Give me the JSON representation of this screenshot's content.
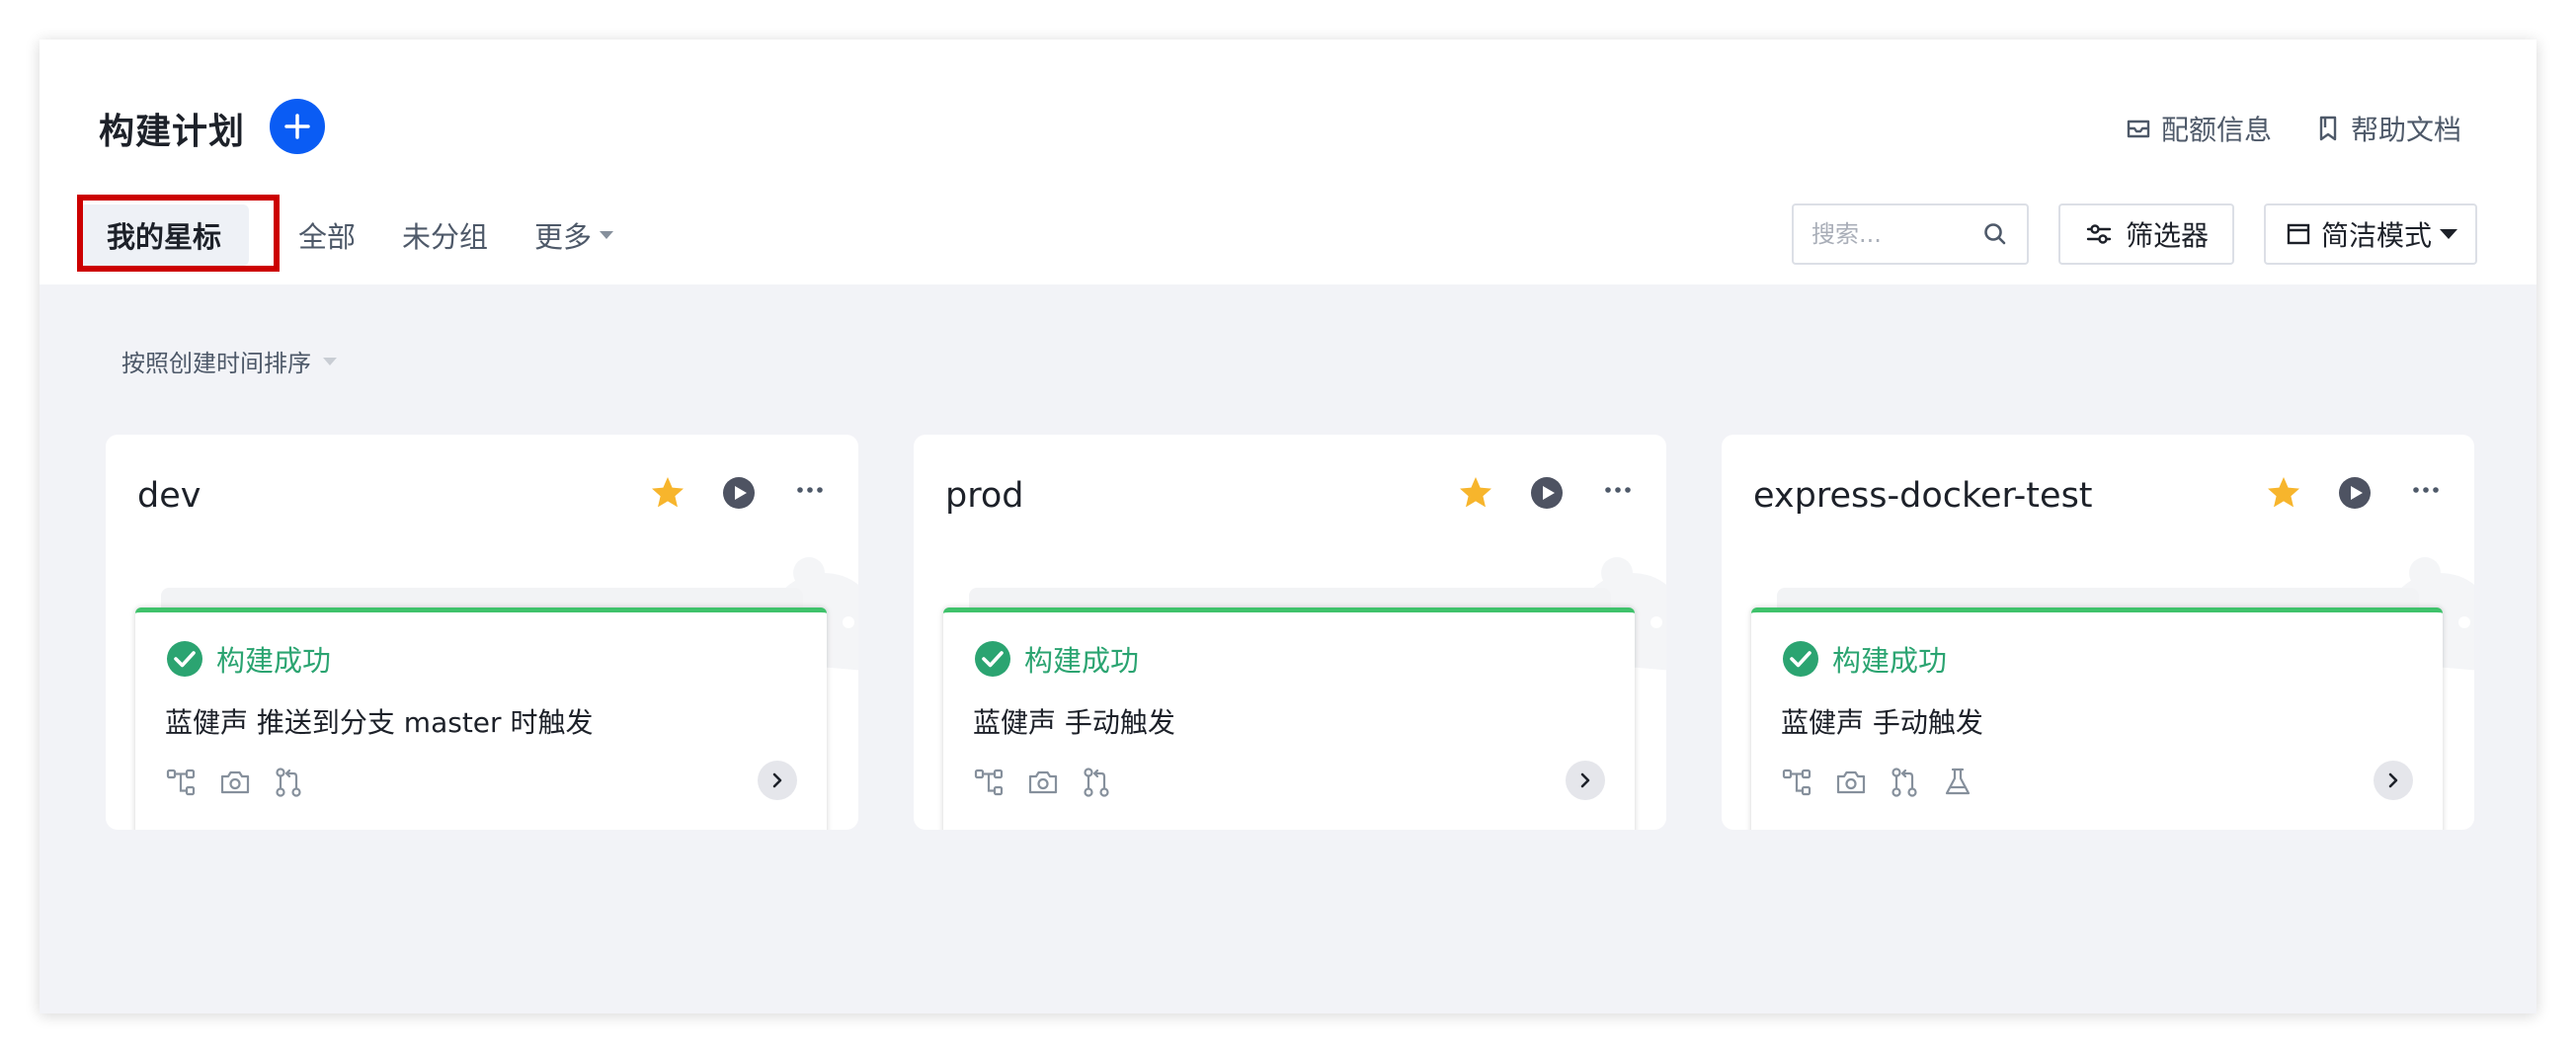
{
  "header": {
    "title": "构建计划",
    "add_icon": "plus-icon",
    "links": [
      {
        "label": "配额信息",
        "icon": "inbox-icon"
      },
      {
        "label": "帮助文档",
        "icon": "bookmark-icon"
      }
    ]
  },
  "tabs": {
    "starred": "我的星标",
    "all": "全部",
    "ungrouped": "未分组",
    "more": "更多"
  },
  "toolbar": {
    "search_placeholder": "搜索...",
    "filter_label": "筛选器",
    "mode_label": "简洁模式"
  },
  "sort_label": "按照创建时间排序",
  "colors": {
    "primary": "#0a5cf4",
    "success": "#2ba471",
    "star": "#f7b52c",
    "highlight": "#cc0000"
  },
  "cards": [
    {
      "name": "dev",
      "status": "构建成功",
      "trigger": "蓝健声 推送到分支 master 时触发"
    },
    {
      "name": "prod",
      "status": "构建成功",
      "trigger": "蓝健声 手动触发"
    },
    {
      "name": "express-docker-test",
      "status": "构建成功",
      "trigger": "蓝健声 手动触发"
    }
  ]
}
